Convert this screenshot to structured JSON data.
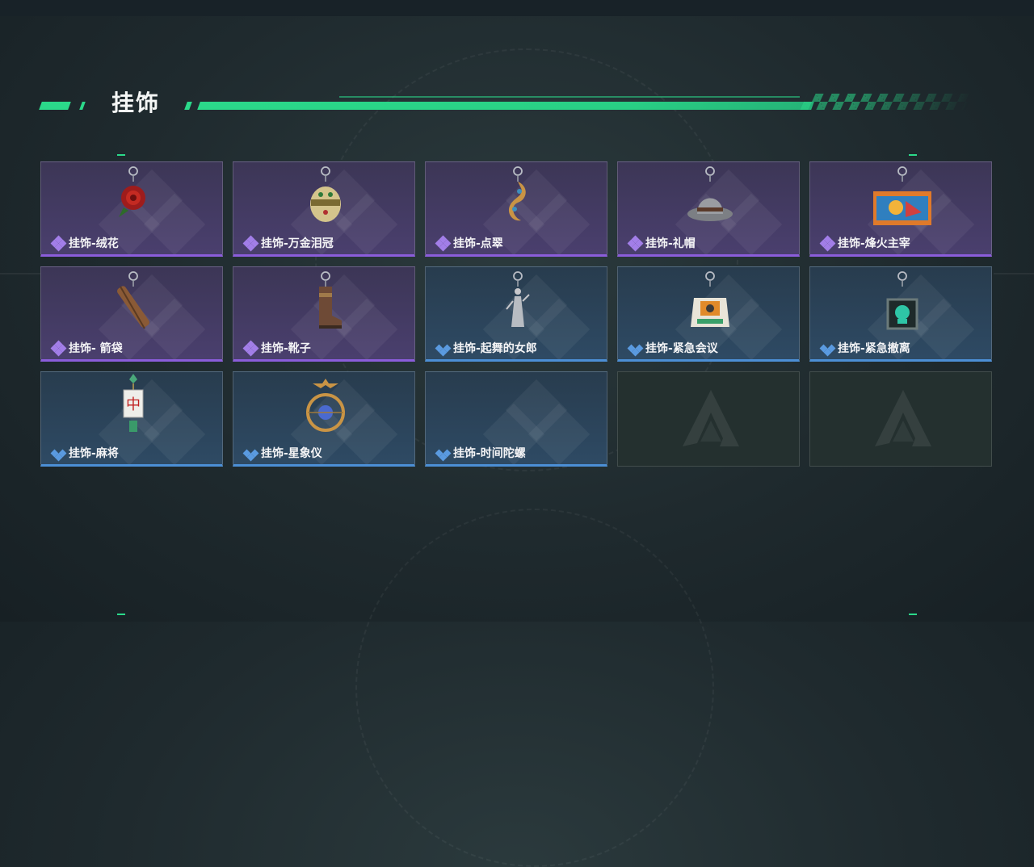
{
  "page": {
    "title": "挂饰"
  },
  "items": [
    {
      "label": "挂饰-绒花",
      "rarity": "purple",
      "icon": "rose-charm-icon"
    },
    {
      "label": "挂饰-万金泪冠",
      "rarity": "purple",
      "icon": "jeweled-box-charm-icon"
    },
    {
      "label": "挂饰-点翠",
      "rarity": "purple",
      "icon": "phoenix-charm-icon"
    },
    {
      "label": "挂饰-礼帽",
      "rarity": "purple",
      "icon": "hat-charm-icon"
    },
    {
      "label": "挂饰-烽火主宰",
      "rarity": "purple",
      "icon": "banner-charm-icon"
    },
    {
      "label": "挂饰- 箭袋",
      "rarity": "purple",
      "icon": "quiver-charm-icon"
    },
    {
      "label": "挂饰-靴子",
      "rarity": "purple",
      "icon": "boot-charm-icon"
    },
    {
      "label": "挂饰-起舞的女郎",
      "rarity": "blue",
      "icon": "dancer-charm-icon"
    },
    {
      "label": "挂饰-紧急会议",
      "rarity": "blue",
      "icon": "robot-charm-icon"
    },
    {
      "label": "挂饰-紧急撤离",
      "rarity": "blue",
      "icon": "frame-charm-icon"
    },
    {
      "label": "挂饰-麻将",
      "rarity": "blue",
      "icon": "mahjong-charm-icon"
    },
    {
      "label": "挂饰-星象仪",
      "rarity": "blue",
      "icon": "astrolabe-charm-icon"
    },
    {
      "label": "挂饰-时间陀螺",
      "rarity": "blue",
      "icon": ""
    },
    {
      "label": "",
      "rarity": "empty",
      "icon": "empty-slot-logo-icon"
    },
    {
      "label": "",
      "rarity": "empty",
      "icon": "empty-slot-logo-icon"
    }
  ],
  "colors": {
    "accent": "#2bd98a",
    "purple": "#8b5ddb",
    "blue": "#4c8fd6"
  }
}
